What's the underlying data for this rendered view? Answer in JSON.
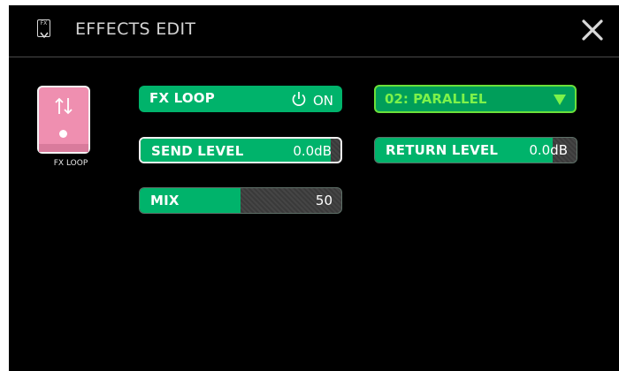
{
  "header": {
    "title": "EFFECTS EDIT",
    "icon_text": "FX"
  },
  "effect_tile": {
    "label": "FX LOOP"
  },
  "controls": {
    "fx_loop": {
      "label": "FX LOOP",
      "state": "ON"
    },
    "mode": {
      "value": "02: PARALLEL"
    },
    "send_level": {
      "label": "SEND LEVEL",
      "value": "0.0dB",
      "fill_fraction": 0.95
    },
    "return_level": {
      "label": "RETURN LEVEL",
      "value": "0.0dB",
      "fill_fraction": 0.88
    },
    "mix": {
      "label": "MIX",
      "value": "50",
      "fill_fraction": 0.5
    }
  },
  "colors": {
    "accent_green": "#00b36b",
    "dropdown_text": "#7df24a",
    "tile_pink": "#ef8fb0"
  }
}
